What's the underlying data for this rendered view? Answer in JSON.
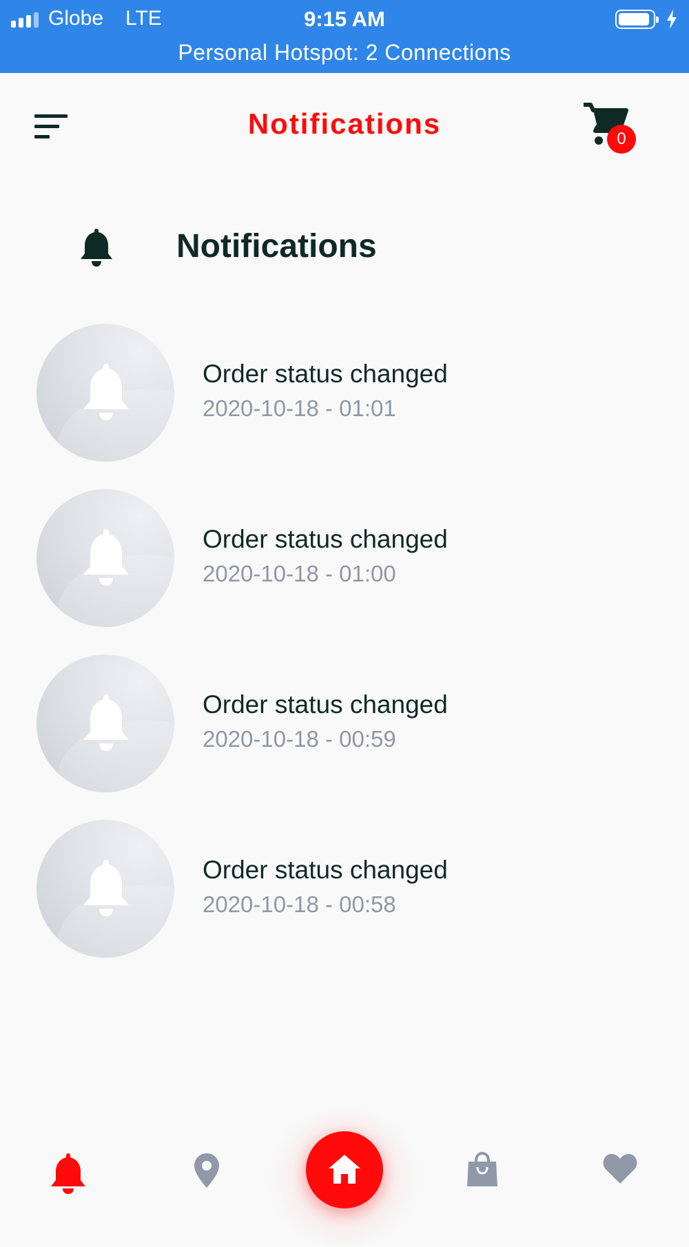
{
  "status_bar": {
    "carrier": "Globe",
    "network": "LTE",
    "time": "9:15 AM",
    "hotspot": "Personal Hotspot: 2 Connections",
    "color": "#2f86e8"
  },
  "header": {
    "title": "Notifications",
    "cart_count": "0",
    "accent_color": "#ff0a0a",
    "menu_icon": "menu-icon",
    "cart_icon": "cart-icon"
  },
  "section": {
    "title": "Notifications",
    "icon": "bell-icon"
  },
  "notifications": [
    {
      "title": "Order status changed",
      "date": "2020-10-18 - 01:01"
    },
    {
      "title": "Order status changed",
      "date": "2020-10-18 - 01:00"
    },
    {
      "title": "Order status changed",
      "date": "2020-10-18 - 00:59"
    },
    {
      "title": "Order status changed",
      "date": "2020-10-18 - 00:58"
    }
  ],
  "bottom_nav": {
    "items": [
      {
        "icon": "bell-icon",
        "active": true
      },
      {
        "icon": "location-pin-icon",
        "active": false
      },
      {
        "icon": "home-icon",
        "active": false
      },
      {
        "icon": "shopping-bag-icon",
        "active": false
      },
      {
        "icon": "heart-icon",
        "active": false
      }
    ],
    "active_color": "#ff0a0a",
    "inactive_color": "#8f99a8"
  }
}
